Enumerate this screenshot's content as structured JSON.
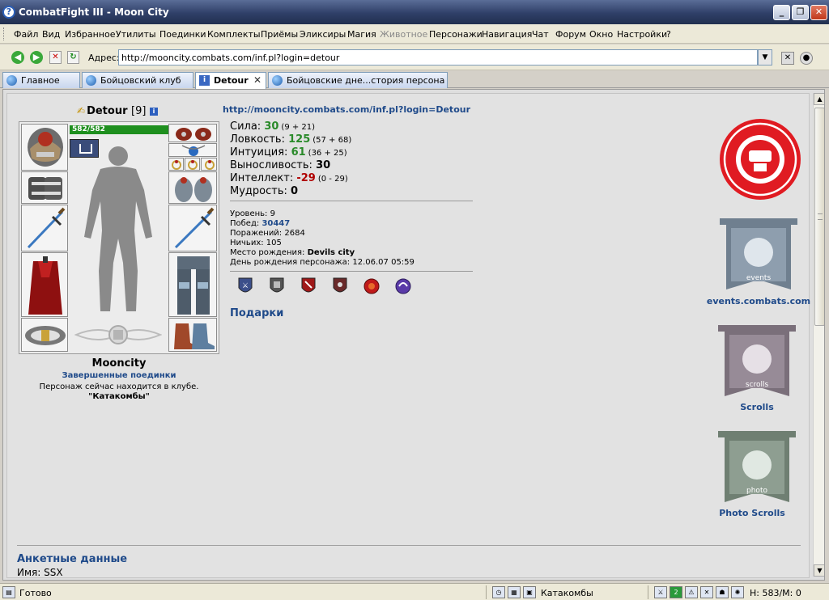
{
  "window": {
    "title": "CombatFight III - Moon City"
  },
  "menu": [
    {
      "label": "Файл",
      "disabled": false
    },
    {
      "label": "Вид",
      "disabled": false
    },
    {
      "label": "Избранное",
      "disabled": false
    },
    {
      "label": "Утилиты",
      "disabled": false
    },
    {
      "label": "Поединки",
      "disabled": false
    },
    {
      "label": "Комплекты",
      "disabled": false
    },
    {
      "label": "Приёмы",
      "disabled": false
    },
    {
      "label": "Эликсиры",
      "disabled": false
    },
    {
      "label": "Магия",
      "disabled": false
    },
    {
      "label": "Животное",
      "disabled": true
    },
    {
      "label": "Персонажи",
      "disabled": false
    },
    {
      "label": "Навигация",
      "disabled": false
    },
    {
      "label": "Чат",
      "disabled": false
    },
    {
      "label": "Форум",
      "disabled": false
    },
    {
      "label": "Окно",
      "disabled": false
    },
    {
      "label": "Настройки",
      "disabled": false
    },
    {
      "label": "?",
      "disabled": false
    }
  ],
  "address": {
    "label": "Адрес:",
    "url": "http://mooncity.combats.com/inf.pl?login=detour"
  },
  "tabs": [
    {
      "label": "Главное",
      "icon": "globe-icon",
      "active": false
    },
    {
      "label": "Бойцовский клуб",
      "icon": "globe-icon",
      "active": false
    },
    {
      "label": "Detour",
      "icon": "info-icon",
      "active": true
    },
    {
      "label": "Бойцовские дне...стория персона",
      "icon": "globe-icon",
      "active": false
    }
  ],
  "character": {
    "nick": "Detour",
    "level": "[9]",
    "hp": "582/582",
    "hp_fraction": 1.0,
    "city": "Mooncity",
    "battles_link": "Завершенные поединки",
    "status": "Персонаж сейчас находится в клубе.",
    "location": "\"Катакомбы\""
  },
  "profile_url": "http://mooncity.combats.com/inf.pl?login=Detour",
  "stats": [
    {
      "label": "Сила:",
      "value": "30",
      "detail": "(9 + 21)",
      "tone": "green"
    },
    {
      "label": "Ловкость:",
      "value": "125",
      "detail": "(57 + 68)",
      "tone": "green"
    },
    {
      "label": "Интуиция:",
      "value": "61",
      "detail": "(36 + 25)",
      "tone": "green"
    },
    {
      "label": "Выносливость:",
      "value": "30",
      "detail": "",
      "tone": "plain"
    },
    {
      "label": "Интеллект:",
      "value": "-29",
      "detail": "(0 - 29)",
      "tone": "red"
    },
    {
      "label": "Мудрость:",
      "value": "0",
      "detail": "",
      "tone": "plain"
    }
  ],
  "info": {
    "level_label": "Уровень:",
    "level_value": "9",
    "wins_label": "Побед:",
    "wins_value": "30447",
    "losses_label": "Поражений:",
    "losses_value": "2684",
    "draws_label": "Ничьих:",
    "draws_value": "105",
    "birthplace_label": "Место рождения:",
    "birthplace_value": "Devils city",
    "birthday_label": "День рождения персонажа:",
    "birthday_value": "12.06.07 05:59"
  },
  "gifts_heading": "Подарки",
  "banners": [
    {
      "label": "events.combats.com",
      "color": "#6f7f8f",
      "caption": "events"
    },
    {
      "label": "Scrolls",
      "color": "#7a6f7a",
      "caption": "scrolls"
    },
    {
      "label": "Photo Scrolls",
      "color": "#6f7f72",
      "caption": "photo"
    }
  ],
  "profile_section": {
    "heading": "Анкетные данные",
    "name_label": "Имя:",
    "name_value": "SSX"
  },
  "statusbar": {
    "ready": "Готово",
    "location": "Катакомбы",
    "hp": "H: 583/M: 0"
  },
  "colors": {
    "link": "#1f4a8a",
    "clan_red": "#e01b22",
    "hp_green": "#1e8f1e"
  }
}
